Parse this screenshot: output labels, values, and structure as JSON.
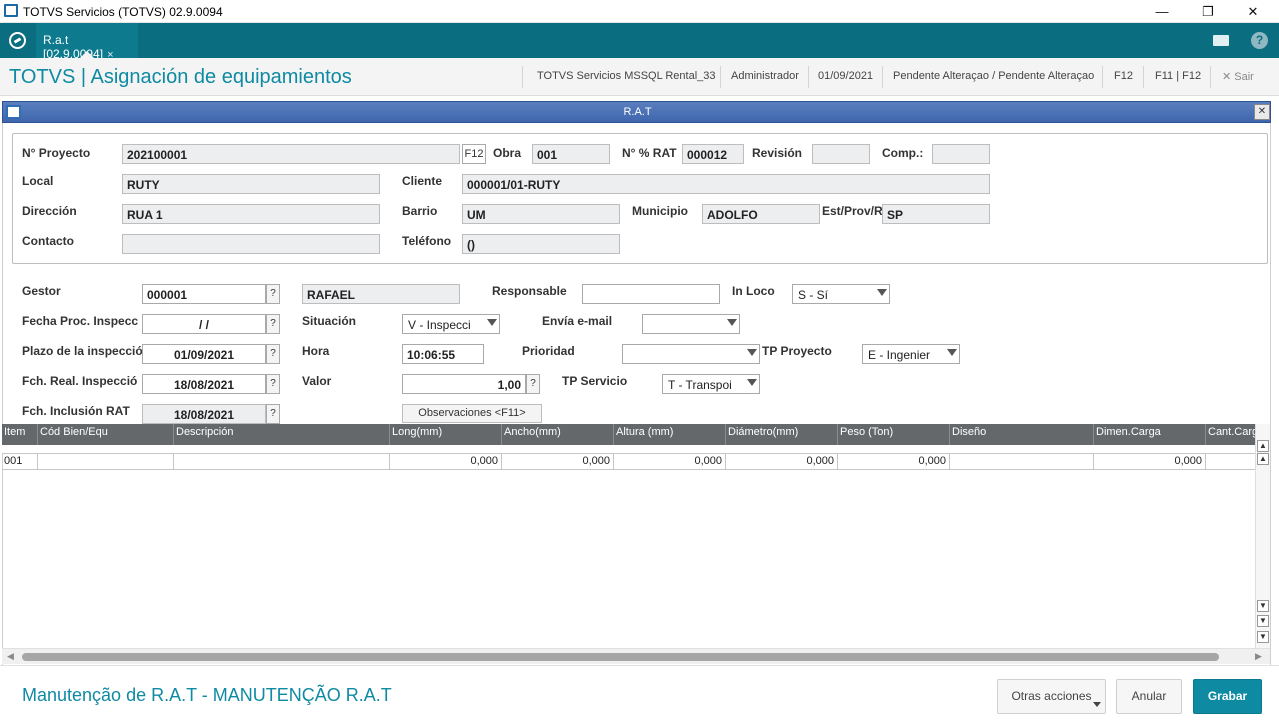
{
  "window": {
    "title": "TOTVS Servicios (TOTVS) 02.9.0094"
  },
  "tabs": [
    {
      "label": "R.a.t [02.9.0094]",
      "close": "×"
    }
  ],
  "header": {
    "app_title": "TOTVS | Asignación de equipamientos",
    "environment": "TOTVS Servicios MSSQL Rental_33",
    "user": "Administrador",
    "date": "01/09/2021",
    "status": "Pendente Alteraçao / Pendente Alteraçao",
    "f12": "F12",
    "f11f12": "F11 | F12",
    "exit": "Sair"
  },
  "dialog": {
    "title": "R.A.T"
  },
  "top_form": {
    "proyecto_label": "N° Proyecto",
    "proyecto": "202100001",
    "f12_btn": "F12",
    "obra_label": "Obra",
    "obra": "001",
    "rat_label": "N° % RAT",
    "rat": "000012",
    "revision_label": "Revisión",
    "revision": "",
    "comp_label": "Comp.:",
    "comp": "",
    "local_label": "Local",
    "local": "RUTY",
    "cliente_label": "Cliente",
    "cliente": "000001/01-RUTY",
    "direccion_label": "Dirección",
    "direccion": "RUA 1",
    "barrio_label": "Barrio",
    "barrio": "UM",
    "municipio_label": "Municipio",
    "municipio": "ADOLFO",
    "estado_label": "Est/Prov/R",
    "estado": "SP",
    "contacto_label": "Contacto",
    "contacto": "",
    "telefono_label": "Teléfono",
    "telefono": "()"
  },
  "form": {
    "gestor_label": "Gestor",
    "gestor": "000001",
    "gestor_name": "RAFAEL",
    "responsable_label": "Responsable",
    "responsable": "",
    "inloco_label": "In Loco",
    "inloco": "S - Sí",
    "fecha_proc_label": "Fecha Proc. Inspecc",
    "fecha_proc": " /  / ",
    "situacion_label": "Situación",
    "situacion": "V - Inspecci",
    "envia_label": "Envía e-mail",
    "envia": "",
    "plazo_label": "Plazo de la inspecció",
    "plazo": "01/09/2021",
    "hora_label": "Hora",
    "hora": "10:06:55",
    "prioridad_label": "Prioridad",
    "prioridad": "",
    "tp_proyecto_label": "TP Proyecto",
    "tp_proyecto": "E - Ingenier",
    "fch_real_label": "Fch. Real. Inspecció",
    "fch_real": "18/08/2021",
    "valor_label": "Valor",
    "valor": "1,00",
    "tp_servicio_label": "TP Servicio",
    "tp_servicio": "T - Transpoi",
    "fch_incl_label": "Fch. Inclusión RAT",
    "fch_incl": "18/08/2021",
    "observaciones_btn": "Observaciones <F11>",
    "q": "?"
  },
  "grid": {
    "columns": [
      "Item",
      "Cód Bien/Equ",
      "Descripción",
      "Long(mm)",
      "Ancho(mm)",
      "Altura (mm)",
      "Diámetro(mm)",
      "Peso (Ton)",
      "Diseño",
      "Dimen.Carga",
      "Cant.Carga"
    ],
    "rows": [
      [
        "001",
        "",
        "",
        "0,000",
        "0,000",
        "0,000",
        "0,000",
        "0,000",
        "",
        "0,000",
        ""
      ]
    ]
  },
  "footer": {
    "title": "Manutenção de R.A.T - MANUTENÇÃO R.A.T",
    "otras": "Otras acciones",
    "anular": "Anular",
    "grabar": "Grabar"
  },
  "colors": {
    "accent": "#0e8aa3",
    "tabbar": "#0b6e80",
    "dialog_bar": "#4a70b4"
  }
}
